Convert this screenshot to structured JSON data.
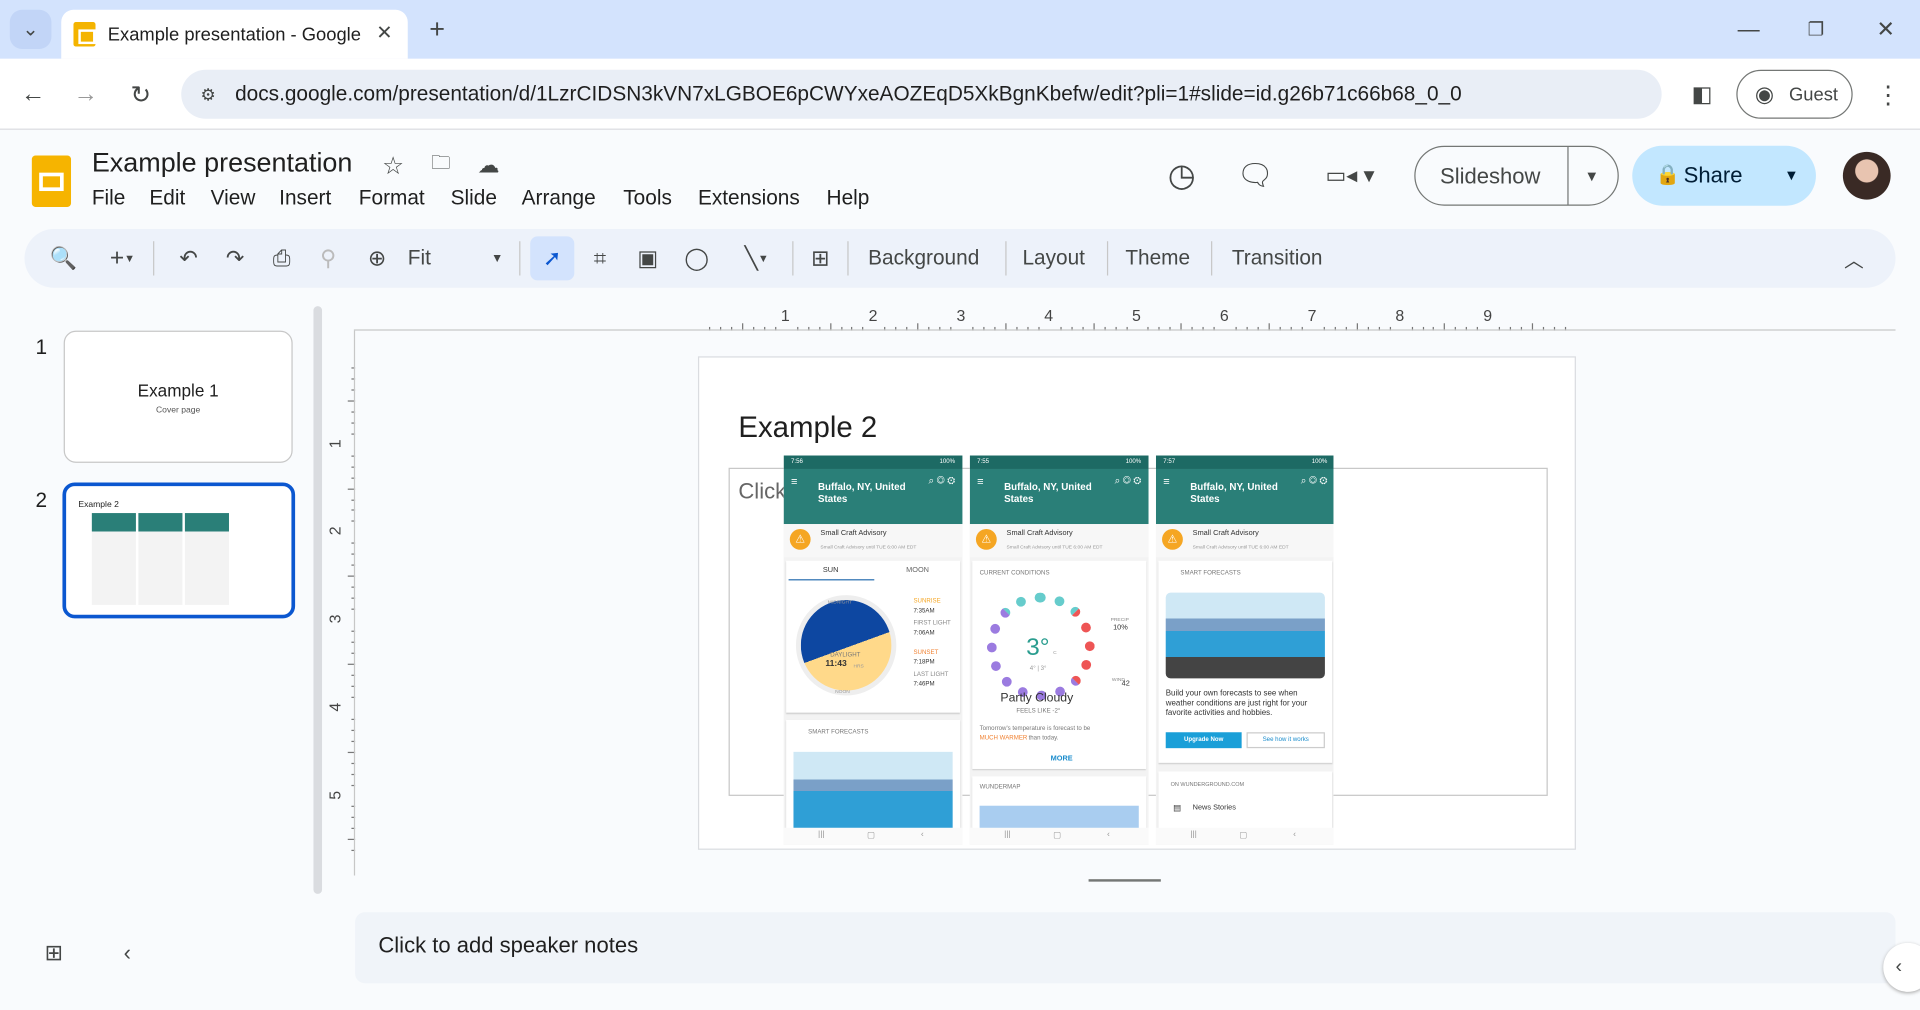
{
  "browser": {
    "tab_title": "Example presentation - Google",
    "url": "docs.google.com/presentation/d/1LzrCIDSN3kVN7xLGBOE6pCWYxeAOZEqD5XkBgnKbefw/edit?pli=1#slide=id.g26b71c66b68_0_0",
    "profile_label": "Guest"
  },
  "doc": {
    "title": "Example presentation",
    "menu": [
      "File",
      "Edit",
      "View",
      "Insert",
      "Format",
      "Slide",
      "Arrange",
      "Tools",
      "Extensions",
      "Help"
    ],
    "slideshow_label": "Slideshow",
    "share_label": "Share"
  },
  "toolbar": {
    "zoom_value": "Fit",
    "background": "Background",
    "layout": "Layout",
    "theme": "Theme",
    "transition": "Transition"
  },
  "ruler": {
    "h": [
      "1",
      "2",
      "3",
      "4",
      "5",
      "6",
      "7",
      "8",
      "9"
    ],
    "v": [
      "1",
      "2",
      "3",
      "4",
      "5"
    ]
  },
  "filmstrip": [
    {
      "number": "1",
      "title": "Example 1",
      "subtitle": "Cover page"
    },
    {
      "number": "2",
      "title": "Example 2"
    }
  ],
  "slide": {
    "title": "Example 2",
    "placeholder": "Click"
  },
  "phones": [
    {
      "time": "7:56",
      "status": "100%",
      "location": "Buffalo, NY, United States",
      "advisory": "Small Craft Advisory",
      "advisory_detail": "Small Craft Advisory until TUE 6:00 AM EDT",
      "tab_sun": "SUN",
      "tab_moon": "MOON",
      "midnight": "MIDNIGHT",
      "noon": "NOON",
      "daylight": "DAYLIGHT",
      "daylight_value": "11:43",
      "hrs": "HRS",
      "sunrise": "SUNRISE",
      "sunrise_time": "7:35AM",
      "first_light": "FIRST LIGHT",
      "first_light_time": "7:06AM",
      "sunset": "SUNSET",
      "sunset_time": "7:18PM",
      "last_light": "LAST LIGHT",
      "last_light_time": "7:46PM",
      "smart": "SMART FORECASTS"
    },
    {
      "time": "7:55",
      "status": "100%",
      "location": "Buffalo, NY, United States",
      "advisory": "Small Craft Advisory",
      "advisory_detail": "Small Craft Advisory until TUE 6:00 AM EDT",
      "current": "CURRENT CONDITIONS",
      "temp": "3°",
      "unit": "C",
      "hilo": "4° | 3°",
      "precip": "PRECIP",
      "precip_value": "10%",
      "wind": "WIND",
      "wind_value": "42",
      "condition": "Partly Cloudy",
      "feels": "FEELS LIKE -2°",
      "tomorrow": "Tomorrow's temperature is forecast to be",
      "warmer": "MUCH WARMER",
      "than": "than today.",
      "more": "MORE",
      "wundermap": "WUNDERMAP"
    },
    {
      "time": "7:57",
      "status": "100%",
      "location": "Buffalo, NY, United States",
      "advisory": "Small Craft Advisory",
      "advisory_detail": "Small Craft Advisory until TUE 6:00 AM EDT",
      "smart": "SMART FORECASTS",
      "build": "Build your own forecasts to see when weather conditions are just right for your favorite activities and hobbies.",
      "upgrade": "Upgrade Now",
      "see_how": "See how it works",
      "on_wu": "ON WUNDERGROUND.COM",
      "news": "News Stories"
    }
  ],
  "notes": {
    "placeholder": "Click to add speaker notes"
  },
  "colors": {
    "tab_bar": "#d3e3fd",
    "share": "#c2e7ff",
    "selected_border": "#0b57d0",
    "teal": "#2a7f78"
  }
}
